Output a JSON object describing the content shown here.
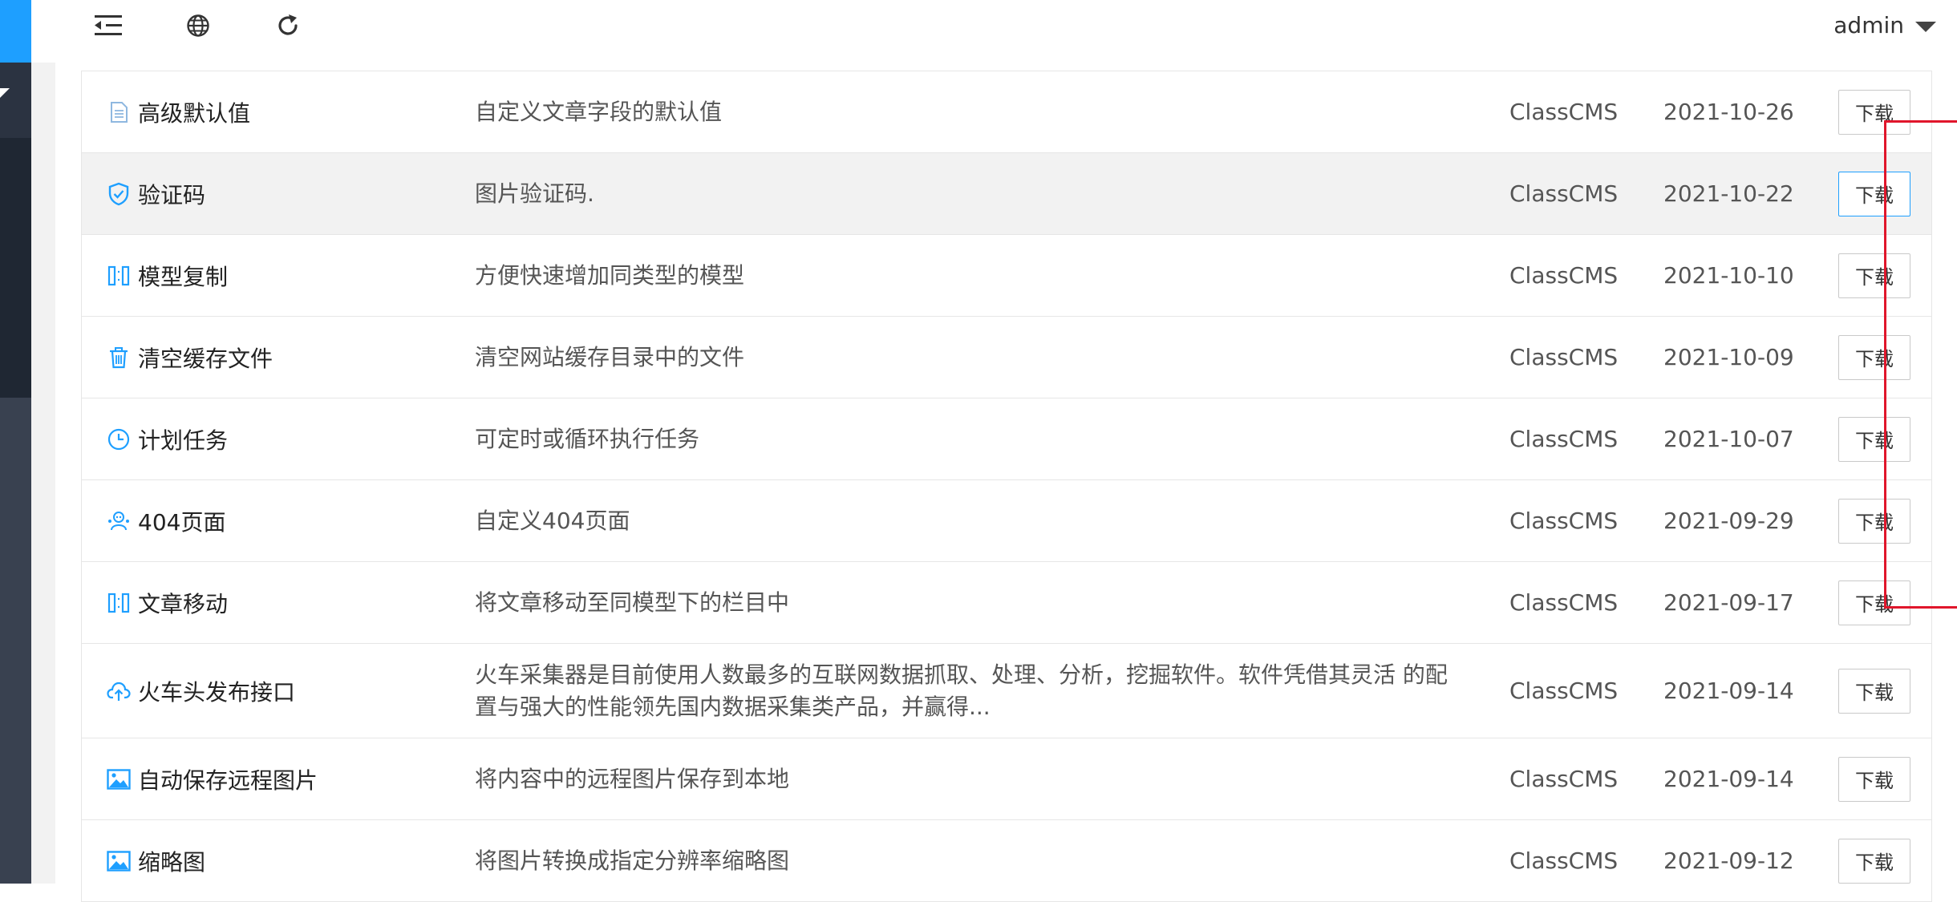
{
  "header": {
    "user_name": "admin"
  },
  "plugins": [
    {
      "icon": "document-icon",
      "name": "高级默认值",
      "desc": "自定义文章字段的默认值",
      "author": "ClassCMS",
      "date": "2021-10-26",
      "button": "下载"
    },
    {
      "icon": "shield-check-icon",
      "name": "验证码",
      "desc": "图片验证码.",
      "author": "ClassCMS",
      "date": "2021-10-22",
      "button": "下载"
    },
    {
      "icon": "copy-model-icon",
      "name": "模型复制",
      "desc": "方便快速增加同类型的模型",
      "author": "ClassCMS",
      "date": "2021-10-10",
      "button": "下载"
    },
    {
      "icon": "trash-icon",
      "name": "清空缓存文件",
      "desc": "清空网站缓存目录中的文件",
      "author": "ClassCMS",
      "date": "2021-10-09",
      "button": "下载"
    },
    {
      "icon": "clock-icon",
      "name": "计划任务",
      "desc": "可定时或循环执行任务",
      "author": "ClassCMS",
      "date": "2021-10-07",
      "button": "下载"
    },
    {
      "icon": "ghost-404-icon",
      "name": "404页面",
      "desc": "自定义404页面",
      "author": "ClassCMS",
      "date": "2021-09-29",
      "button": "下载"
    },
    {
      "icon": "move-article-icon",
      "name": "文章移动",
      "desc": "将文章移动至同模型下的栏目中",
      "author": "ClassCMS",
      "date": "2021-09-17",
      "button": "下载"
    },
    {
      "icon": "cloud-upload-icon",
      "name": "火车头发布接口",
      "desc": "火车采集器是目前使用人数最多的互联网数据抓取、处理、分析，挖掘软件。软件凭借其灵活 的配置与强大的性能领先国内数据采集类产品，并赢得...",
      "author": "ClassCMS",
      "date": "2021-09-14",
      "button": "下载"
    },
    {
      "icon": "image-icon",
      "name": "自动保存远程图片",
      "desc": "将内容中的远程图片保存到本地",
      "author": "ClassCMS",
      "date": "2021-09-14",
      "button": "下载"
    },
    {
      "icon": "image-icon",
      "name": "缩略图",
      "desc": "将图片转换成指定分辨率缩略图",
      "author": "ClassCMS",
      "date": "2021-09-12",
      "button": "下载"
    }
  ],
  "colors": {
    "accent": "#1e9fff",
    "sidebar": "#394150",
    "highlight_box": "#e0162b"
  }
}
